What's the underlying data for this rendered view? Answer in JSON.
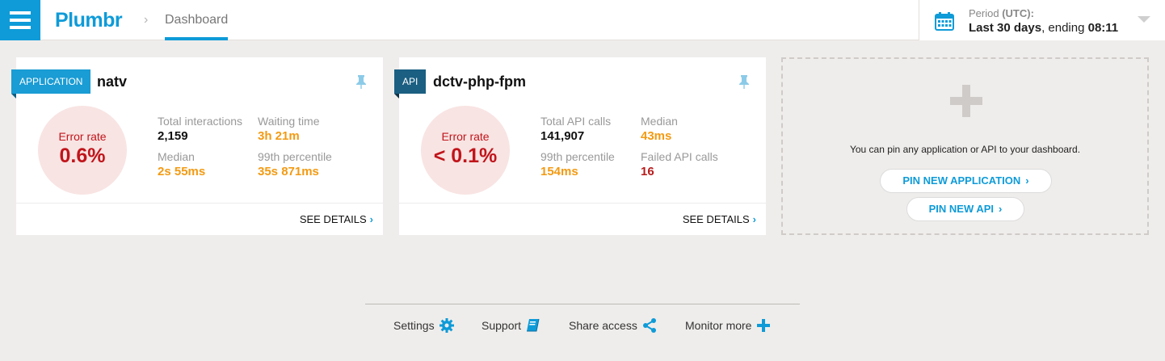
{
  "header": {
    "brand": "Plumbr",
    "breadcrumb_separator": "›",
    "breadcrumb_current": "Dashboard",
    "period": {
      "label_prefix": "Period ",
      "label_suffix": "(UTC):",
      "range": "Last 30 days",
      "ending_text": ", ending ",
      "ending_time": "08:11"
    }
  },
  "cards": [
    {
      "tag": "APPLICATION",
      "title": "natv",
      "error_label": "Error rate",
      "error_value": "0.6%",
      "stats": [
        {
          "label": "Total interactions",
          "value": "2,159"
        },
        {
          "label": "Waiting time",
          "value": "3h 21m"
        },
        {
          "label": "Median",
          "value": "2s 55ms"
        },
        {
          "label": "99th percentile",
          "value": "35s 871ms"
        }
      ],
      "details": "SEE DETAILS"
    },
    {
      "tag": "API",
      "title": "dctv-php-fpm",
      "error_label": "Error rate",
      "error_value": "< 0.1%",
      "stats": [
        {
          "label": "Total API calls",
          "value": "141,907"
        },
        {
          "label": "Median",
          "value": "43ms"
        },
        {
          "label": "99th percentile",
          "value": "154ms"
        },
        {
          "label": "Failed API calls",
          "value": "16"
        }
      ],
      "details": "SEE DETAILS"
    }
  ],
  "placeholder": {
    "text": "You can pin any application or API to your dashboard.",
    "pin_app": "PIN NEW APPLICATION",
    "pin_api": "PIN NEW API"
  },
  "footer": {
    "settings": "Settings",
    "support": "Support",
    "share": "Share access",
    "monitor": "Monitor more"
  },
  "colors": {
    "accent": "#0e9bd8",
    "error": "#c0151b",
    "warning": "#f39a12",
    "api_tag": "#1b5f82"
  }
}
